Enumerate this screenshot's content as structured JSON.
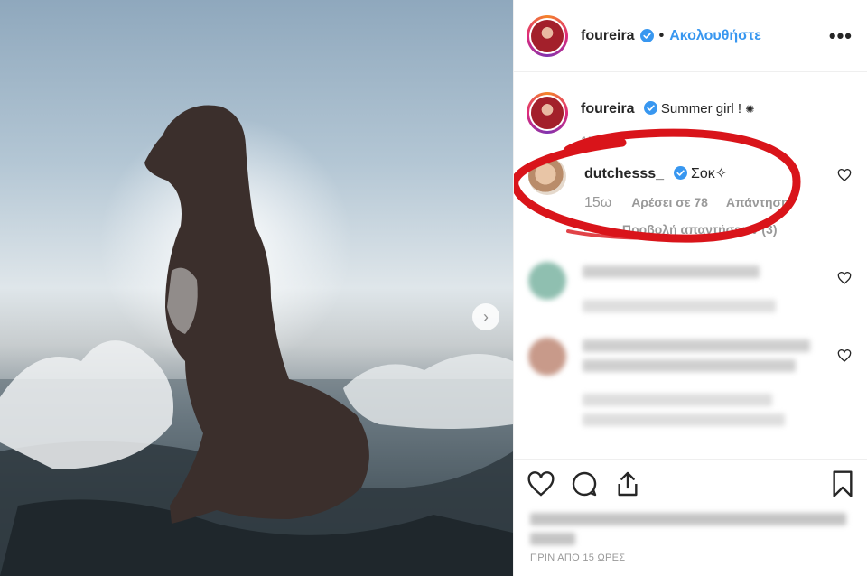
{
  "post": {
    "username": "foureira",
    "follow_label": "Ακολουθήστε",
    "dot": "•",
    "more_label": "•••",
    "next_label": "›"
  },
  "caption": {
    "username": "foureira",
    "text": "Summer girl !",
    "emoji": "✺",
    "time": "15ω"
  },
  "reply": {
    "username": "dutchesss_",
    "text": "Σοκ✧",
    "time": "15ω",
    "likes_label": "Αρέσει σε 78",
    "reply_label": "Απάντηση",
    "view_replies_label": "Προβολή απαντήσεων (3)"
  },
  "footer": {
    "timestamp": "ΠΡΙΝ ΑΠΟ 15 ΩΡΕΣ"
  },
  "colors": {
    "accent": "#3897f0",
    "annotation_red": "#d9141a",
    "verified": "#3897f0"
  },
  "icons": [
    "verified-icon",
    "more-icon",
    "heart-icon",
    "comment-icon",
    "share-icon",
    "bookmark-icon",
    "chevron-right-icon"
  ]
}
